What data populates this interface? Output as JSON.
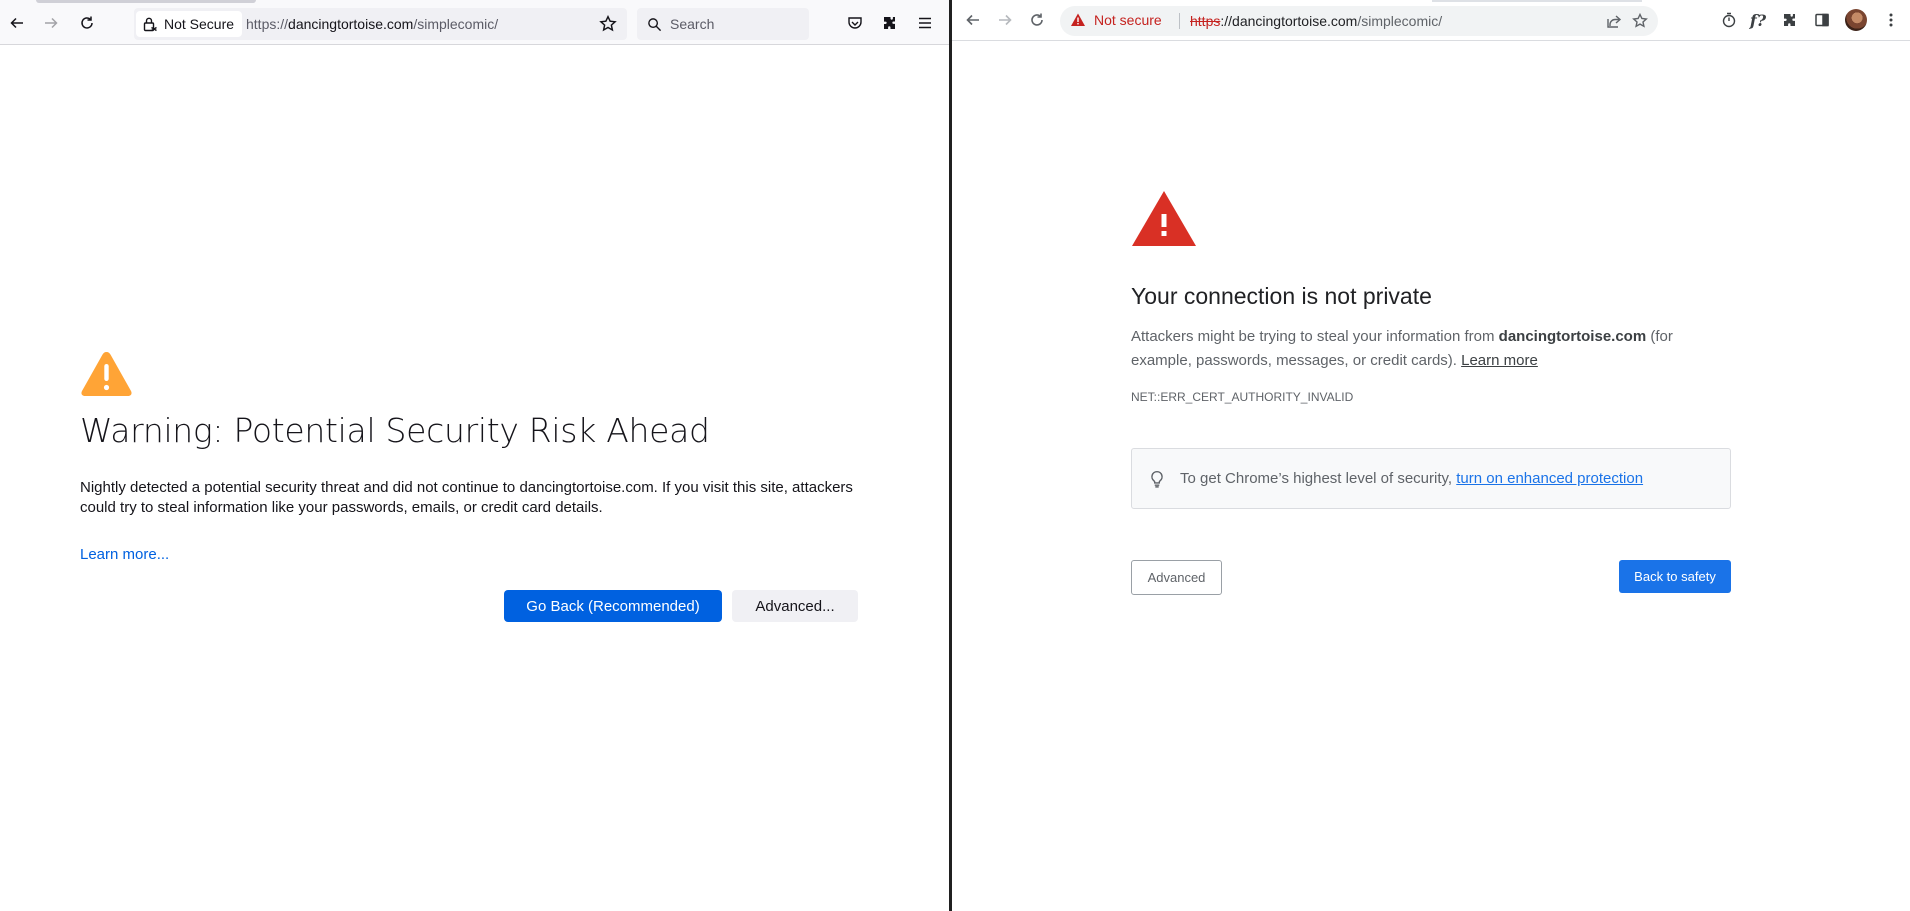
{
  "firefox": {
    "security_label": "Not Secure",
    "url_scheme": "https://",
    "url_host": "dancingtortoise.com",
    "url_path": "/simplecomic/",
    "search_placeholder": "Search",
    "title": "Warning: Potential Security Risk Ahead",
    "description": "Nightly detected a potential security threat and did not continue to dancingtortoise.com. If you visit this site, attackers could try to steal information like your passwords, emails, or credit card details.",
    "learn_more": "Learn more...",
    "go_back_label": "Go Back (Recommended)",
    "advanced_label": "Advanced...",
    "colors": {
      "warning": "#ffa436",
      "primary": "#0061e0"
    }
  },
  "chrome": {
    "security_label": "Not secure",
    "url_scheme": "https",
    "url_rest": "://dancingtortoise.com",
    "url_path": "/simplecomic/",
    "profile_ext_label": "f?",
    "title": "Your connection is not private",
    "desc_prefix": "Attackers might be trying to steal your information from ",
    "desc_host": "dancingtortoise.com",
    "desc_suffix": " (for example, passwords, messages, or credit cards). ",
    "learn_more": "Learn more",
    "error_code": "NET::ERR_CERT_AUTHORITY_INVALID",
    "enhanced_prefix": "To get Chrome’s highest level of security, ",
    "enhanced_link": "turn on enhanced protection",
    "advanced_label": "Advanced",
    "back_label": "Back to safety",
    "colors": {
      "warning": "#d93025",
      "primary": "#1a73e8"
    }
  }
}
